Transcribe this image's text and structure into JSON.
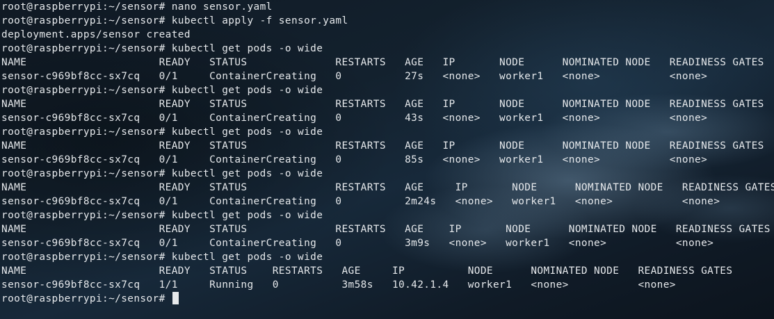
{
  "terminal": {
    "prompt": "root@raspberrypi:~/sensor# ",
    "lines": [
      "root@raspberrypi:~/sensor# nano sensor.yaml",
      "root@raspberrypi:~/sensor# kubectl apply -f sensor.yaml",
      "deployment.apps/sensor created",
      "root@raspberrypi:~/sensor# kubectl get pods -o wide",
      "NAME                     READY   STATUS              RESTARTS   AGE   IP       NODE      NOMINATED NODE   READINESS GATES",
      "sensor-c969bf8cc-sx7cq   0/1     ContainerCreating   0          27s   <none>   worker1   <none>           <none>",
      "root@raspberrypi:~/sensor# kubectl get pods -o wide",
      "NAME                     READY   STATUS              RESTARTS   AGE   IP       NODE      NOMINATED NODE   READINESS GATES",
      "sensor-c969bf8cc-sx7cq   0/1     ContainerCreating   0          43s   <none>   worker1   <none>           <none>",
      "root@raspberrypi:~/sensor# kubectl get pods -o wide",
      "NAME                     READY   STATUS              RESTARTS   AGE   IP       NODE      NOMINATED NODE   READINESS GATES",
      "sensor-c969bf8cc-sx7cq   0/1     ContainerCreating   0          85s   <none>   worker1   <none>           <none>",
      "root@raspberrypi:~/sensor# kubectl get pods -o wide",
      "NAME                     READY   STATUS              RESTARTS   AGE     IP       NODE      NOMINATED NODE   READINESS GATES",
      "sensor-c969bf8cc-sx7cq   0/1     ContainerCreating   0          2m24s   <none>   worker1   <none>           <none>",
      "root@raspberrypi:~/sensor# kubectl get pods -o wide",
      "NAME                     READY   STATUS              RESTARTS   AGE    IP       NODE      NOMINATED NODE   READINESS GATES",
      "sensor-c969bf8cc-sx7cq   0/1     ContainerCreating   0          3m9s   <none>   worker1   <none>           <none>",
      "root@raspberrypi:~/sensor# kubectl get pods -o wide",
      "NAME                     READY   STATUS    RESTARTS   AGE     IP          NODE      NOMINATED NODE   READINESS GATES",
      "sensor-c969bf8cc-sx7cq   1/1     Running   0          3m58s   10.42.1.4   worker1   <none>           <none>"
    ],
    "current_input": ""
  }
}
